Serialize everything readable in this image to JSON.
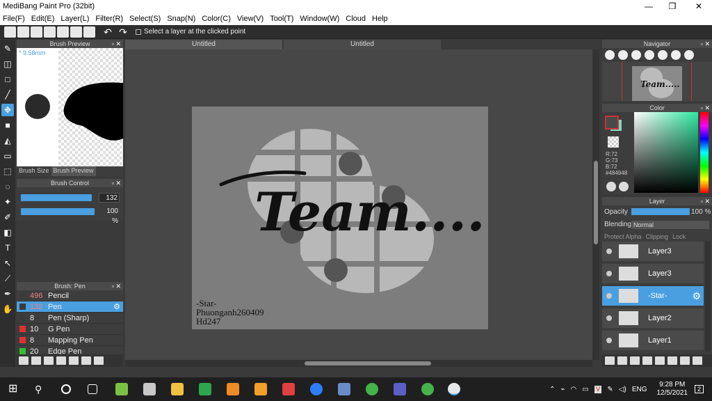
{
  "window": {
    "title": "MediBang Paint Pro (32bit)",
    "minimize_glyph": "—",
    "maximize_glyph": "❐",
    "close_glyph": "✕"
  },
  "menu": [
    "File(F)",
    "Edit(E)",
    "Layer(L)",
    "Filter(R)",
    "Select(S)",
    "Snap(N)",
    "Color(C)",
    "View(V)",
    "Tool(T)",
    "Window(W)",
    "Cloud",
    "Help"
  ],
  "toolbar": {
    "undo_glyph": "↶",
    "redo_glyph": "↷",
    "select_layer_label": "Select a layer at the clicked point"
  },
  "tools": [
    "brush-tool",
    "eraser-tool",
    "rectangle-tool",
    "dot-tool",
    "move-tool",
    "fill-rect-tool",
    "bucket-tool",
    "gradient-tool",
    "select-rect-tool",
    "lasso-tool",
    "magic-wand-tool",
    "select-pen-tool",
    "select-eraser-tool",
    "text-tool",
    "operation-tool",
    "eyedropper-tool",
    "pen-tool",
    "hand-tool"
  ],
  "tool_glyphs": {
    "text": "T",
    "hand": "✋"
  },
  "brush_preview": {
    "title": "Brush Preview",
    "size": "* 9.58mm",
    "tab_size": "Brush Size",
    "tab_preview": "Brush Preview"
  },
  "brush_control": {
    "title": "Brush Control",
    "size_value": "132",
    "opacity_value": "100 %",
    "size_fraction": 0.96,
    "opacity_fraction": 1.0
  },
  "brush_list": {
    "title": "Brush: Pen",
    "items": [
      {
        "size": "496",
        "name": "Pencil",
        "color": "#3a3a3a",
        "size_color": "#f08080"
      },
      {
        "size": "132",
        "name": "Pen",
        "color": "#3a3a3a",
        "size_color": "#f08080",
        "selected": true
      },
      {
        "size": "8",
        "name": "Pen (Sharp)",
        "color": "#3a3a3a",
        "size_color": "#eee"
      },
      {
        "size": "10",
        "name": "G Pen",
        "color": "#e03030",
        "size_color": "#eee"
      },
      {
        "size": "8",
        "name": "Mapping Pen",
        "color": "#e03030",
        "size_color": "#eee"
      },
      {
        "size": "20",
        "name": "Edge Pen",
        "color": "#30c030",
        "size_color": "#eee"
      }
    ]
  },
  "doc_tabs": [
    "Untitled",
    "Untitled"
  ],
  "canvas": {
    "heading": "Team.....",
    "signature": [
      "-Star-",
      "Phuonganh260409",
      "Hd247"
    ]
  },
  "navigator": {
    "title": "Navigator",
    "preview_heading": "Team....."
  },
  "color": {
    "title": "Color",
    "r": "R:72",
    "g": "G:73",
    "b": "B:72",
    "hex": "#484948",
    "fg": "#484948",
    "bg": "#7fd8c4"
  },
  "layer": {
    "title": "Layer",
    "opacity_label": "Opacity",
    "opacity_value": "100 %",
    "blending_label": "Blending",
    "blending_value": "Normal",
    "protect_alpha": "Protect Alpha",
    "clipping": "Clipping",
    "lock": "Lock",
    "items": [
      {
        "name": "Layer3",
        "selected": false
      },
      {
        "name": "Layer3",
        "selected": false
      },
      {
        "name": "-Star-",
        "selected": true
      },
      {
        "name": "Layer2",
        "selected": false
      },
      {
        "name": "Layer1",
        "selected": false
      }
    ]
  },
  "taskbar": {
    "lang": "ENG",
    "time": "9:28 PM",
    "date": "12/5/2021",
    "notifications": "2"
  }
}
